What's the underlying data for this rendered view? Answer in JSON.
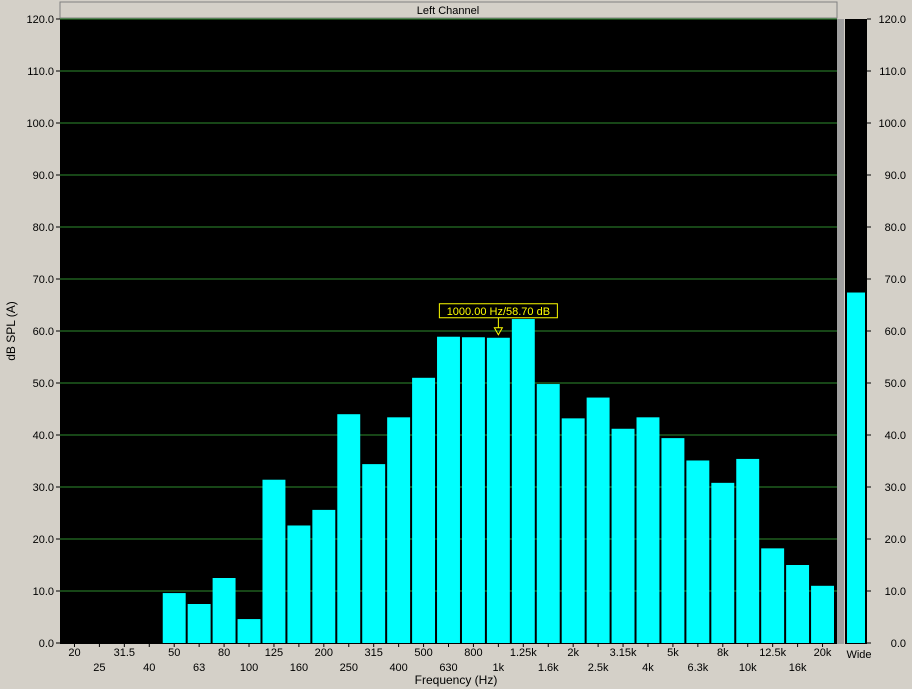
{
  "window": {
    "title": "Left Channel"
  },
  "colors": {
    "bar": "#00ffff",
    "grid": "#2e8b2e",
    "plot_bg": "#000000",
    "annotation_bg": "#000000",
    "annotation_border": "#ffff00",
    "annotation_text": "#ffff00"
  },
  "chart_data": [
    {
      "type": "bar",
      "xlabel": "Frequency (Hz)",
      "ylabel": "dB SPL (A)",
      "ylim": [
        0,
        120
      ],
      "yticks": [
        "0.0",
        "10.0",
        "20.0",
        "30.0",
        "40.0",
        "50.0",
        "60.0",
        "70.0",
        "80.0",
        "90.0",
        "100.0",
        "110.0",
        "120.0"
      ],
      "grid": true,
      "categories": [
        "20",
        "25",
        "31.5",
        "40",
        "50",
        "63",
        "80",
        "100",
        "125",
        "160",
        "200",
        "250",
        "315",
        "400",
        "500",
        "630",
        "800",
        "1k",
        "1.25k",
        "1.6k",
        "2k",
        "2.5k",
        "3.15k",
        "4k",
        "5k",
        "6.3k",
        "8k",
        "10k",
        "12.5k",
        "16k",
        "20k"
      ],
      "values": [
        0,
        0,
        0,
        0,
        9.6,
        7.5,
        12.5,
        4.6,
        31.4,
        22.6,
        25.6,
        44.0,
        34.4,
        43.4,
        51.0,
        58.9,
        58.8,
        58.7,
        62.3,
        49.8,
        43.2,
        47.2,
        41.2,
        43.4,
        39.4,
        35.1,
        30.8,
        35.4,
        18.2,
        15.0,
        11.0
      ],
      "annotation": {
        "label": "1000.00 Hz/58.70 dB",
        "category": "1k",
        "value": 58.7
      }
    },
    {
      "type": "bar",
      "categories": [
        "Wide"
      ],
      "values": [
        67.4
      ],
      "ylim": [
        0,
        120
      ],
      "yticks": [
        "0.0",
        "10.0",
        "20.0",
        "30.0",
        "40.0",
        "50.0",
        "60.0",
        "70.0",
        "80.0",
        "90.0",
        "100.0",
        "110.0",
        "120.0"
      ]
    }
  ]
}
